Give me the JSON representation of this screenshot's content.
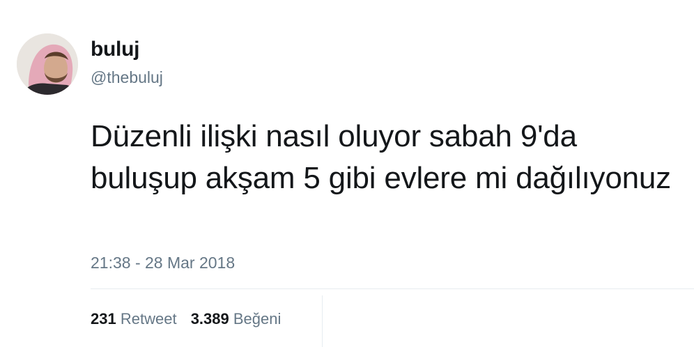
{
  "user": {
    "display_name": "buluj",
    "handle": "@thebuluj"
  },
  "tweet": {
    "text": "Düzenli ilişki nasıl oluyor sabah 9'da buluşup akşam 5 gibi evlere mi dağılıyonuz",
    "timestamp": "21:38 - 28 Mar 2018"
  },
  "stats": {
    "retweet_count": "231",
    "retweet_label": "Retweet",
    "like_count": "3.389",
    "like_label": "Beğeni"
  },
  "colors": {
    "text_primary": "#14171a",
    "text_secondary": "#657786",
    "divider": "#e6ecf0"
  }
}
